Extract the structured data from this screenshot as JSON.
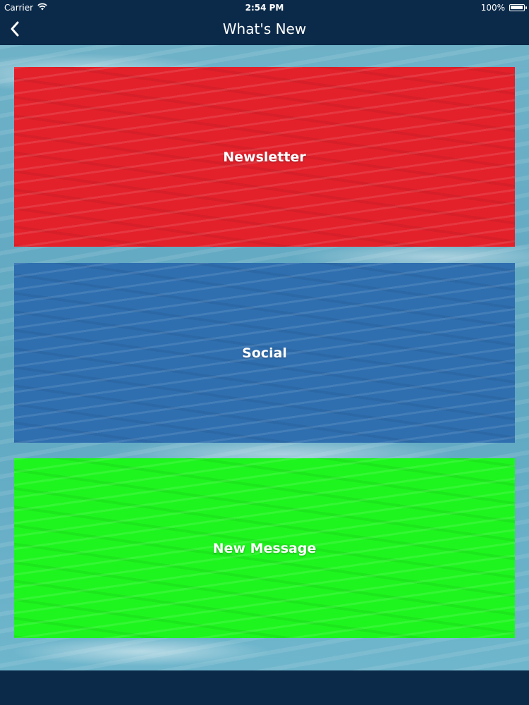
{
  "status_bar": {
    "carrier": "Carrier",
    "time": "2:54 PM",
    "battery": "100%",
    "wifi_icon": "wifi-icon",
    "battery_icon": "battery-icon"
  },
  "nav": {
    "title": "What's New",
    "back_icon": "chevron-left-icon"
  },
  "tiles": [
    {
      "label": "Newsletter",
      "color": "#e3212b"
    },
    {
      "label": "Social",
      "color": "#2f6fb0"
    },
    {
      "label": "New Message",
      "color": "#1ef51e"
    }
  ],
  "colors": {
    "bars": "#0b2a4a"
  }
}
